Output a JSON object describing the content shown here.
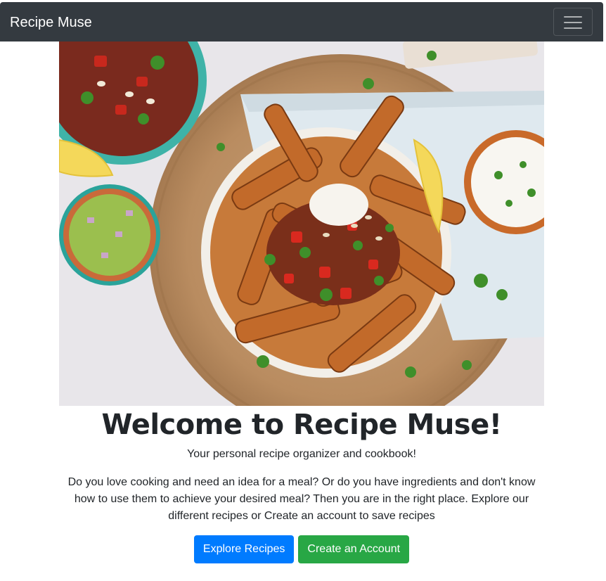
{
  "navbar": {
    "brand": "Recipe Muse",
    "toggler_icon": "hamburger-menu-icon"
  },
  "hero": {
    "image_subject": "food-bowl-photo"
  },
  "main": {
    "title": "Welcome to Recipe Muse!",
    "subtitle": "Your personal recipe organizer and cookbook!",
    "description": "Do you love cooking and need an idea for a meal? Or do you have ingredients and don't know how to use them to achieve your desired meal? Then you are in the right place. Explore our different recipes or Create an account to save recipes",
    "buttons": {
      "explore": "Explore Recipes",
      "create_account": "Create an Account"
    }
  },
  "colors": {
    "navbar_bg": "#343a40",
    "primary": "#007bff",
    "success": "#28a745",
    "text": "#212529"
  }
}
